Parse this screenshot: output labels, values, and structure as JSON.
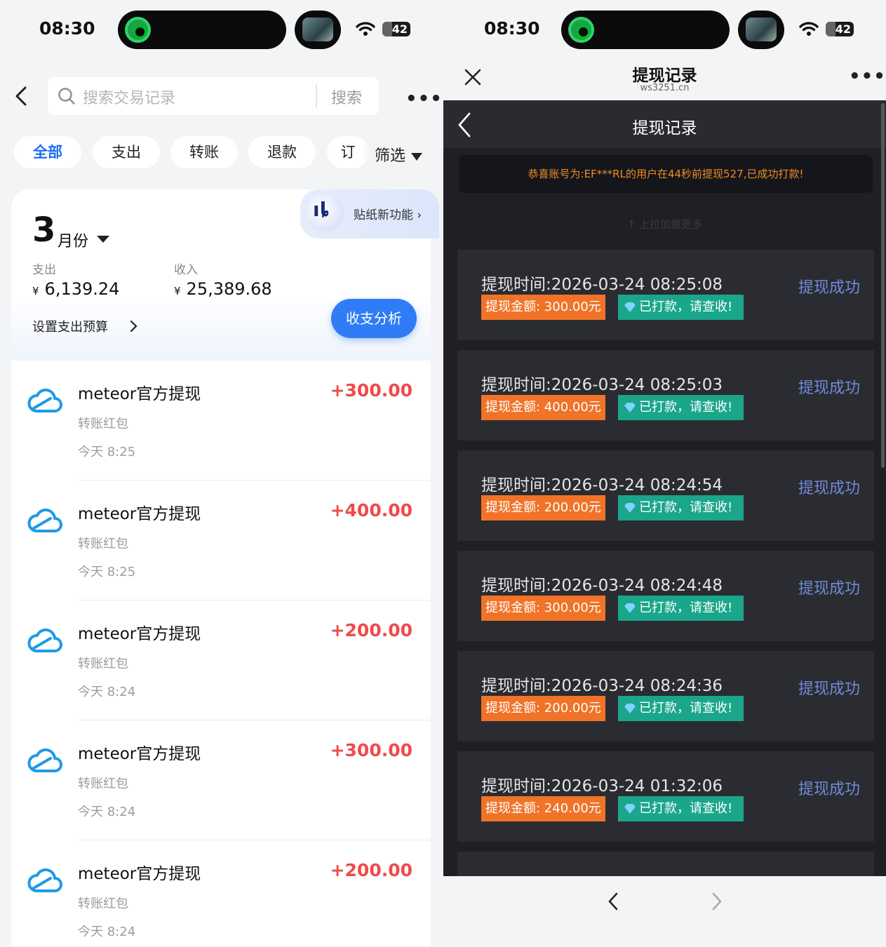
{
  "left": {
    "status": {
      "time": "08:30",
      "battery": "42"
    },
    "search": {
      "placeholder": "搜索交易记录",
      "button": "搜索"
    },
    "more": "•••",
    "chips": [
      "全部",
      "支出",
      "转账",
      "退款",
      "订"
    ],
    "filter": "筛选",
    "sticker_label": "贴纸新功能 ›",
    "summary": {
      "month_num": "3",
      "month_unit": "月份",
      "expense_label": "支出",
      "expense_currency": "¥",
      "expense_value": "6,139.24",
      "income_label": "收入",
      "income_currency": "¥",
      "income_value": "25,389.68",
      "budget_label": "设置支出预算",
      "analysis_button": "收支分析"
    },
    "transactions": [
      {
        "title": "meteor官方提现",
        "subtitle": "转账红包",
        "time": "今天 8:25",
        "amount": "+300.00"
      },
      {
        "title": "meteor官方提现",
        "subtitle": "转账红包",
        "time": "今天 8:25",
        "amount": "+400.00"
      },
      {
        "title": "meteor官方提现",
        "subtitle": "转账红包",
        "time": "今天 8:24",
        "amount": "+200.00"
      },
      {
        "title": "meteor官方提现",
        "subtitle": "转账红包",
        "time": "今天 8:24",
        "amount": "+300.00"
      },
      {
        "title": "meteor官方提现",
        "subtitle": "转账红包",
        "time": "今天 8:24",
        "amount": "+200.00"
      }
    ]
  },
  "right": {
    "status": {
      "time": "08:30",
      "battery": "42"
    },
    "header": {
      "title": "提现记录",
      "url": "ws3251.cn",
      "more": "•••"
    },
    "webview": {
      "title": "提现记录",
      "notice": "恭喜账号为:EF***RL的用户在44秒前提现527,已成功打款!",
      "pull_hint": "↑ 上拉加载更多"
    },
    "records": [
      {
        "time": "提现时间:2026-03-24 08:25:08",
        "amount": "提现金额: 300.00元",
        "paid": "已打款，请查收!",
        "status": "提现成功"
      },
      {
        "time": "提现时间:2026-03-24 08:25:03",
        "amount": "提现金额: 400.00元",
        "paid": "已打款，请查收!",
        "status": "提现成功"
      },
      {
        "time": "提现时间:2026-03-24 08:24:54",
        "amount": "提现金额: 200.00元",
        "paid": "已打款，请查收!",
        "status": "提现成功"
      },
      {
        "time": "提现时间:2026-03-24 08:24:48",
        "amount": "提现金额: 300.00元",
        "paid": "已打款，请查收!",
        "status": "提现成功"
      },
      {
        "time": "提现时间:2026-03-24 08:24:36",
        "amount": "提现金额: 200.00元",
        "paid": "已打款，请查收!",
        "status": "提现成功"
      },
      {
        "time": "提现时间:2026-03-24 01:32:06",
        "amount": "提现金额: 240.00元",
        "paid": "已打款，请查收!",
        "status": "提现成功"
      }
    ]
  },
  "colors": {
    "accent_blue": "#2f7cf6",
    "income_red": "#ef4a4a",
    "badge_orange": "#f07328",
    "badge_teal": "#1aa68a",
    "status_link": "#6f8bd8"
  }
}
